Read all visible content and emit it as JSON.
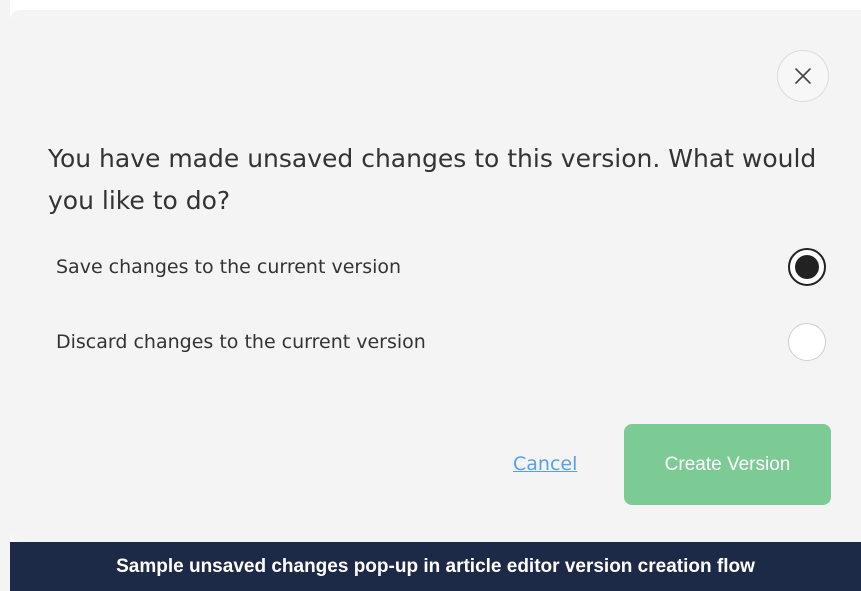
{
  "dialog": {
    "close_icon": "close-icon",
    "question": "You have made unsaved changes to this version. What would you like to do?",
    "options": [
      {
        "label": "Save changes to the current version",
        "selected": true
      },
      {
        "label": "Discard changes to the current version",
        "selected": false
      }
    ],
    "cancel_label": "Cancel",
    "create_label": "Create Version"
  },
  "caption": {
    "text": "Sample unsaved changes pop-up in article editor version creation flow"
  },
  "colors": {
    "dialog_background": "#f4f4f4",
    "primary_button": "#7dcb94",
    "link": "#5aa0e8",
    "caption_background": "#1c2947"
  }
}
